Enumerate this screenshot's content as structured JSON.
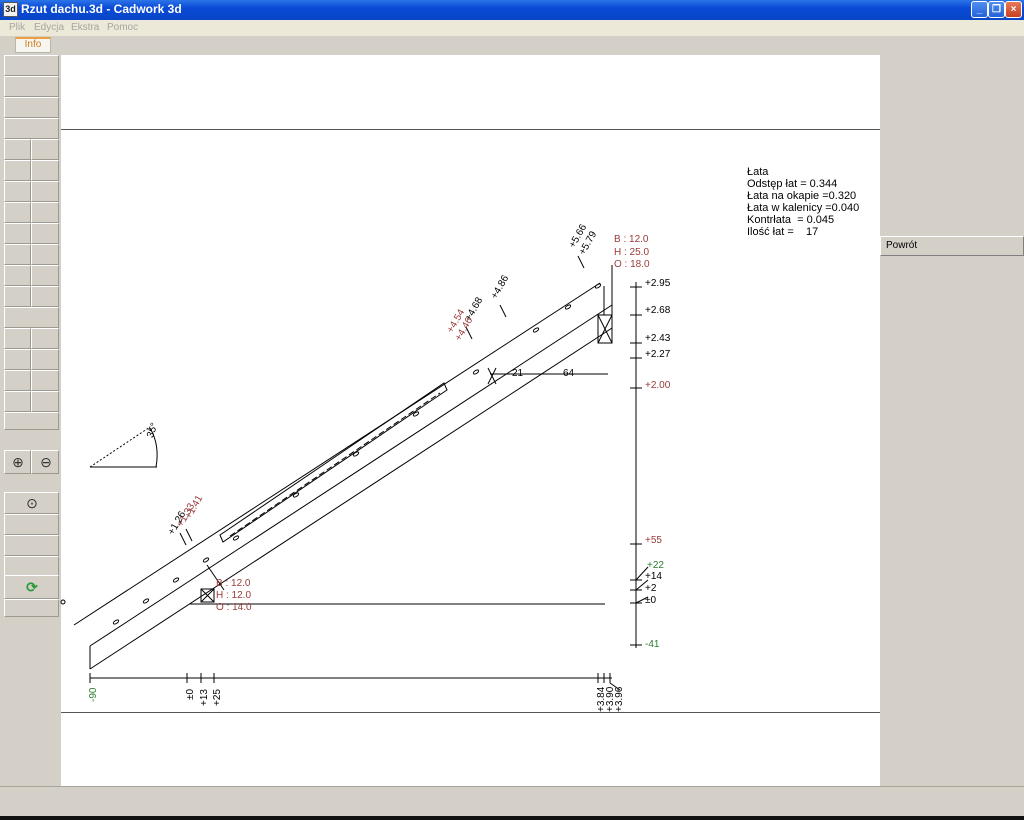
{
  "window": {
    "title": "Rzut dachu.3d - Cadwork 3d",
    "icon": "app-icon"
  },
  "menu": [
    "Plik",
    "Edycja",
    "Ekstra",
    "Pomoc"
  ],
  "tab": {
    "info_label": "Info"
  },
  "toolbar": {
    "icons": [
      "zoom-in-icon",
      "zoom-out-icon",
      "zoom-window-icon",
      "refresh-icon"
    ]
  },
  "right_panel": {
    "back_label": "Powrót"
  },
  "info": {
    "title": "Łata",
    "lines": [
      "Odstęp łat = 0.344",
      "Łata na okapie =0.320",
      "Łata w kalenicy =0.040",
      "Kontrłata  = 0.045",
      "Ilość łat =    17"
    ]
  },
  "drawing": {
    "angle_label": "35°",
    "ridge_section": {
      "b": "B : 12.0",
      "h": "H : 25.0",
      "o": "O : 18.0"
    },
    "eave_section": {
      "b": "B : 12.0",
      "h": "H : 12.0",
      "o": "O : 14.0"
    },
    "horizontal_dims": {
      "a": "21",
      "b": "64"
    },
    "right_scale": [
      "+2.95",
      "+2.68",
      "+2.43",
      "+2.27",
      "+2.00",
      "+55",
      "+22",
      "+14",
      "+2",
      "±0",
      "-41"
    ],
    "bottom_scale": [
      "-90",
      "±0",
      "+13",
      "+25",
      "+3.84",
      "+3.90",
      "+3.96"
    ],
    "slope_labels_top": [
      "+5.66",
      "+5.79",
      "+4.86",
      "+4.68",
      "+4.54",
      "+4.46"
    ],
    "slope_labels_bottom": [
      "+1.41",
      "+1.33",
      "+1.26"
    ]
  }
}
